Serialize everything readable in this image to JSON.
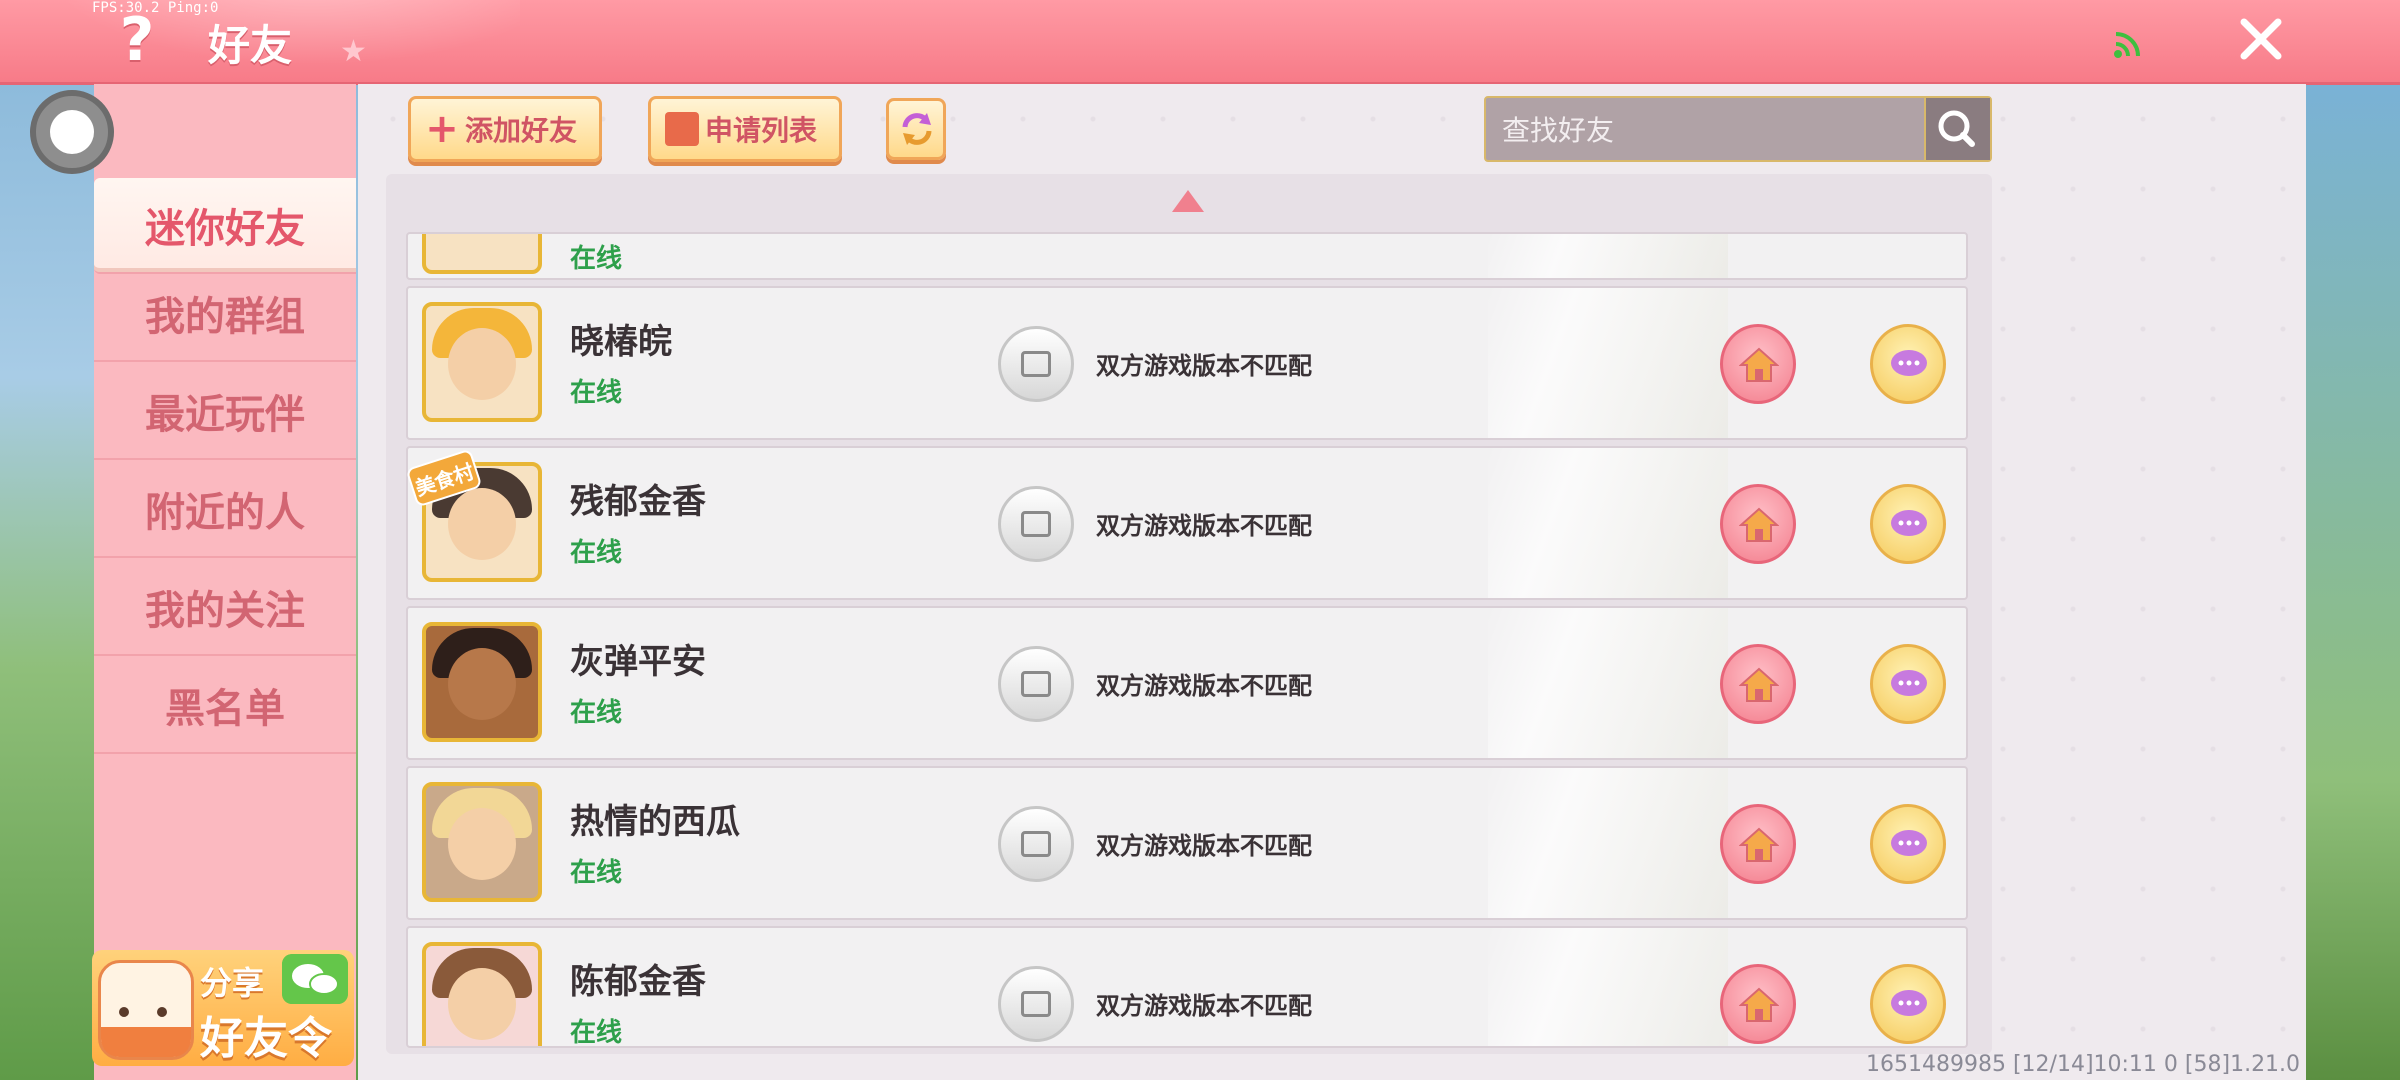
{
  "fps_text": "FPS:30.2  Ping:0",
  "header": {
    "title": "好友"
  },
  "sidebar": {
    "items": [
      {
        "label": "迷你好友",
        "active": true
      },
      {
        "label": "我的群组"
      },
      {
        "label": "最近玩伴"
      },
      {
        "label": "附近的人"
      },
      {
        "label": "我的关注"
      },
      {
        "label": "黑名单"
      }
    ],
    "share": {
      "line1": "分享",
      "line2": "好友令"
    }
  },
  "toolbar": {
    "add_friend_label": "添加好友",
    "requests_label": "申请列表"
  },
  "search": {
    "placeholder": "查找好友"
  },
  "friends": [
    {
      "name": "",
      "status": "在线",
      "partial": true
    },
    {
      "name": "晓椿皖",
      "status": "在线",
      "note": "双方游戏版本不匹配"
    },
    {
      "name": "残郁金香",
      "status": "在线",
      "note": "双方游戏版本不匹配",
      "badge": "美食村"
    },
    {
      "name": "灰弹平安",
      "status": "在线",
      "note": "双方游戏版本不匹配"
    },
    {
      "name": "热情的西瓜",
      "status": "在线",
      "note": "双方游戏版本不匹配"
    },
    {
      "name": "陈郁金香",
      "status": "在线",
      "note": "双方游戏版本不匹配"
    }
  ],
  "footer": {
    "info": "1651489985   [12/14]10:11 0   [58]1.21.0"
  },
  "colors": {
    "header": "#f77b88",
    "accent": "#e4576b",
    "online": "#2ea04b",
    "avatar_border": "#e8b636"
  }
}
